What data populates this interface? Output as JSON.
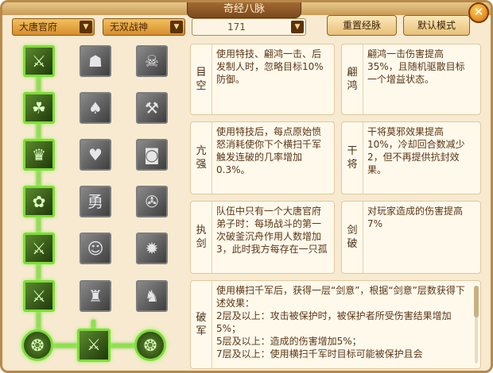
{
  "title": "奇经八脉",
  "close_symbol": "✕",
  "dropdowns": {
    "faction": "大唐官府",
    "school": "无双战神",
    "number": "171"
  },
  "buttons": {
    "reset": "重置经脉",
    "default": "默认模式"
  },
  "icons": {
    "arrow": "▼",
    "tree": [
      [
        "⚔",
        "☗",
        "☠"
      ],
      [
        "☘",
        "♠",
        "⚒"
      ],
      [
        "♛",
        "♥",
        "◙"
      ],
      [
        "✿",
        "勇",
        "✇"
      ],
      [
        "⚔",
        "☺",
        "✹"
      ],
      [
        "⚔",
        "♜",
        "♞"
      ]
    ],
    "bottom": [
      "❂",
      "⚔",
      "❂"
    ]
  },
  "skills": [
    {
      "name": "目空",
      "desc": "使用特技、翩鸿一击、后发制人时，忽略目标10%防御。"
    },
    {
      "name": "翩鸿",
      "desc": "翩鸿一击伤害提高35%，且随机驱散目标一个增益状态。"
    },
    {
      "name": "亢强",
      "desc": "使用特技后，每点原始愤怒消耗使你下个横扫千军触发连破的几率增加0.3%。"
    },
    {
      "name": "干将",
      "desc": "干将莫邪效果提高10%，冷却回合数减少2，但不再提供抗封效果。"
    },
    {
      "name": "执剑",
      "desc": "队伍中只有一个大唐官府弟子时：每场战斗的第一次破釜沉舟作用人数增加3，此时我方每存在一只孤"
    },
    {
      "name": "剑破",
      "desc": "对玩家造成的伤害提高7%"
    },
    {
      "name": "破军",
      "desc": "使用横扫千军后，获得一层“剑意”，根据“剑意”层数获得下述效果：\n2层及以上：攻击被保护时，被保护者所受伤害结果增加5%；\n5层及以上：造成的伤害增加5%；\n7层及以上：使用横扫千军时目标可能被保护且会"
    }
  ]
}
